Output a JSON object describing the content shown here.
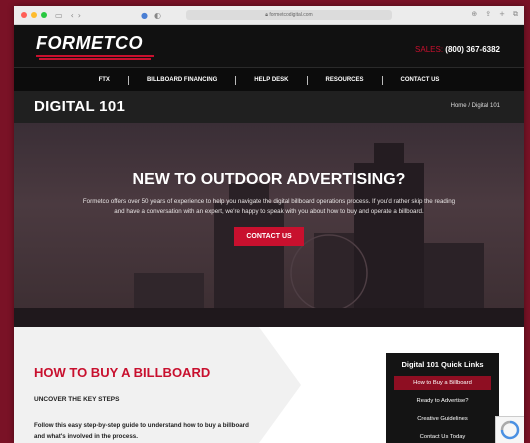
{
  "browser": {
    "url": "formetcodigital.com",
    "back_icon": "‹",
    "forward_icon": "›"
  },
  "header": {
    "logo_text": "FORMETCO",
    "phone_label": "SALES:",
    "phone_number": "(800) 367-6382"
  },
  "nav": {
    "items": [
      "FTX",
      "BILLBOARD FINANCING",
      "HELP DESK",
      "RESOURCES",
      "CONTACT US"
    ]
  },
  "page": {
    "title": "DIGITAL 101",
    "breadcrumb": "Home  /  Digital 101"
  },
  "hero": {
    "heading": "NEW TO OUTDOOR ADVERTISING?",
    "text": "Formetco offers over 50 years of experience to help you navigate the digital billboard operations process. If you'd rather skip the reading and have a conversation with an expert, we're happy to speak with you about how to buy and operate a billboard.",
    "cta_label": "CONTACT US"
  },
  "section": {
    "heading": "HOW TO BUY A BILLBOARD",
    "subheading": "UNCOVER THE KEY STEPS",
    "description": "Follow this easy step-by-step guide to understand how to buy a billboard and what's involved in the process."
  },
  "quick_links": {
    "title": "Digital 101 Quick Links",
    "items": [
      "How to Buy a Billboard",
      "Ready to Advertise?",
      "Creative Guidelines",
      "Contact Us Today"
    ]
  },
  "colors": {
    "brand_red": "#c8102e",
    "dark": "#111111",
    "background": "#7a1226"
  }
}
